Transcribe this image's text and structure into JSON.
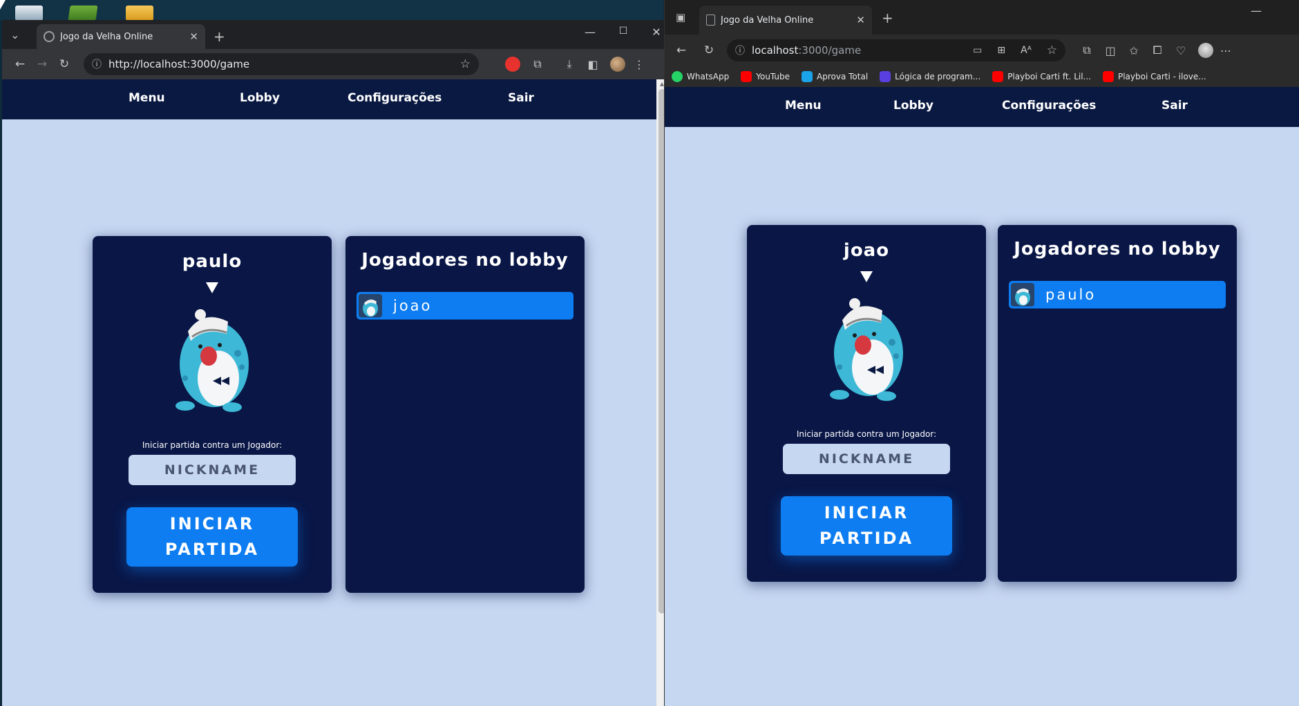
{
  "left_browser": {
    "tab_title": "Jogo da Velha Online",
    "url": "http://localhost:3000/game",
    "page": {
      "nav": [
        "Menu",
        "Lobby",
        "Configurações",
        "Sair"
      ],
      "player_name": "paulo",
      "challenge_label": "Iniciar partida contra um Jogador:",
      "nickname_placeholder": "NICKNAME",
      "start_button_line1": "INICIAR",
      "start_button_line2": "PARTIDA",
      "lobby_title": "Jogadores no lobby",
      "lobby_players": [
        "joao"
      ]
    }
  },
  "right_browser": {
    "tab_title": "Jogo da Velha Online",
    "url_host": "localhost",
    "url_path": ":3000/game",
    "bookmarks": [
      {
        "label": "WhatsApp",
        "icon": "whatsapp-icon"
      },
      {
        "label": "YouTube",
        "icon": "youtube-icon"
      },
      {
        "label": "Aprova Total",
        "icon": "aprova-total-icon"
      },
      {
        "label": "Lógica de program...",
        "icon": "logica-icon"
      },
      {
        "label": "Playboi Carti ft. Lil...",
        "icon": "youtube-icon"
      },
      {
        "label": "Playboi Carti - ilove...",
        "icon": "youtube-icon"
      }
    ],
    "page": {
      "nav": [
        "Menu",
        "Lobby",
        "Configurações",
        "Sair"
      ],
      "player_name": "joao",
      "challenge_label": "Iniciar partida contra um Jogador:",
      "nickname_placeholder": "NICKNAME",
      "start_button_line1": "INICIAR",
      "start_button_line2": "PARTIDA",
      "lobby_title": "Jogadores no lobby",
      "lobby_players": [
        "paulo"
      ]
    }
  },
  "colors": {
    "nav_bg": "#0a1942",
    "panel_bg": "#091646",
    "page_bg": "#c6d7f2",
    "accent": "#0d7df1"
  }
}
